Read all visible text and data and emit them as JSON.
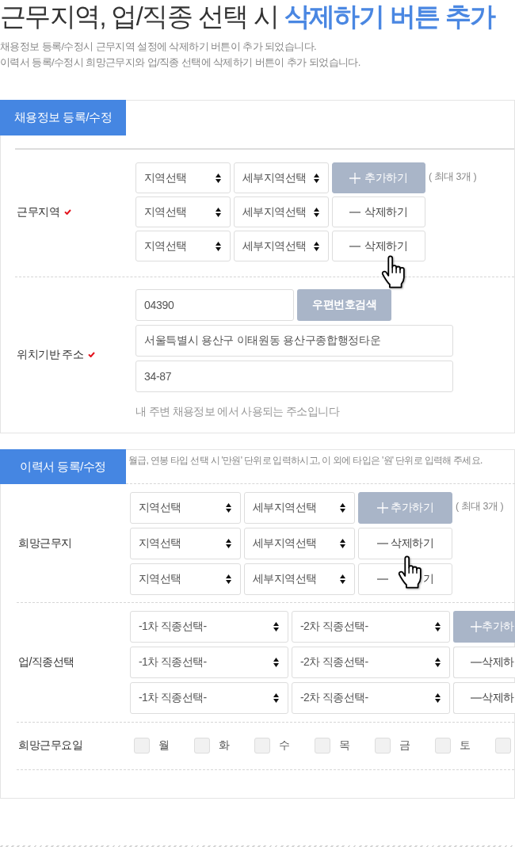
{
  "header": {
    "title": "근무지역, 업/직종 선택 시 **삭제하기 버튼 추가**",
    "description": [
      "채용정보 등록/수정시 근무지역 설정에 삭제하기 버튼이 추가 되었습니다.",
      "이력서 등록/수정시 희망근무지와 업/직종 선택에 삭제하기 버튼이 추가 되었습니다."
    ]
  },
  "sections": [
    {
      "tab": "채용정보 등록/수정",
      "rows": [
        {
          "kind": "select_group",
          "label": "근무지역",
          "required": true,
          "note": "( 최대 3개 )",
          "lines": [
            {
              "selects": [
                "지역선택",
                "세부지역선택"
              ],
              "button": {
                "kind": "add",
                "label": "추가하기",
                "hovered": false
              }
            },
            {
              "selects": [
                "지역선택",
                "세부지역선택"
              ],
              "button": {
                "kind": "remove",
                "label": "삭제하기",
                "hovered": false
              }
            },
            {
              "selects": [
                "지역선택",
                "세부지역선택"
              ],
              "button": {
                "kind": "remove",
                "label": "삭제하기",
                "hovered": true
              }
            }
          ]
        },
        {
          "kind": "address",
          "label": "위치기반 주소",
          "required": true,
          "postcode": "04390",
          "search_button": "우편번호검색",
          "address": "서울특별시 용산구 이태원동 용산구종합행정타운",
          "address_detail": "34-87",
          "hint": "내 주변 채용정보 에서 사용되는 주소입니다"
        }
      ]
    },
    {
      "tab": "이력서 등록/수정",
      "notice": "월급, 연봉 타입 선택 시 '만원' 단위로 입력하시고, 이 외에 타입은 '원' 단위로 입력해 주세요.",
      "rows": [
        {
          "kind": "select_group",
          "label": "희망근무지",
          "required": false,
          "note": "( 최대 3개 )",
          "lines": [
            {
              "selects": [
                "지역선택",
                "세부지역선택"
              ],
              "button": {
                "kind": "add",
                "label": "추가하기",
                "hovered": false
              }
            },
            {
              "selects": [
                "지역선택",
                "세부지역선택"
              ],
              "button": {
                "kind": "remove",
                "label": "삭제하기",
                "hovered": true
              }
            },
            {
              "selects": [
                "지역선택",
                "세부지역선택"
              ],
              "button": {
                "kind": "remove",
                "label": "기",
                "hovered": false
              }
            }
          ]
        },
        {
          "kind": "select_group",
          "label": "업/직종선택",
          "required": false,
          "lines": [
            {
              "selects": [
                "-1차 직종선택-",
                "-2차 직종선택-"
              ],
              "button": {
                "kind": "add",
                "label": "추가하",
                "hovered": false
              }
            },
            {
              "selects": [
                "-1차 직종선택-",
                "-2차 직종선택-"
              ],
              "button": {
                "kind": "remove",
                "label": "삭제하",
                "hovered": false
              }
            },
            {
              "selects": [
                "-1차 직종선택-",
                "-2차 직종선택-"
              ],
              "button": {
                "kind": "remove",
                "label": "삭제하",
                "hovered": false
              }
            }
          ]
        },
        {
          "kind": "checkboxes",
          "label": "희망근무요일",
          "required": false,
          "options": [
            {
              "label": "월",
              "checked": false
            },
            {
              "label": "화",
              "checked": false
            },
            {
              "label": "수",
              "checked": false
            },
            {
              "label": "목",
              "checked": false
            },
            {
              "label": "금",
              "checked": false
            },
            {
              "label": "토",
              "checked": false
            },
            {
              "checked": false
            }
          ]
        }
      ]
    }
  ]
}
